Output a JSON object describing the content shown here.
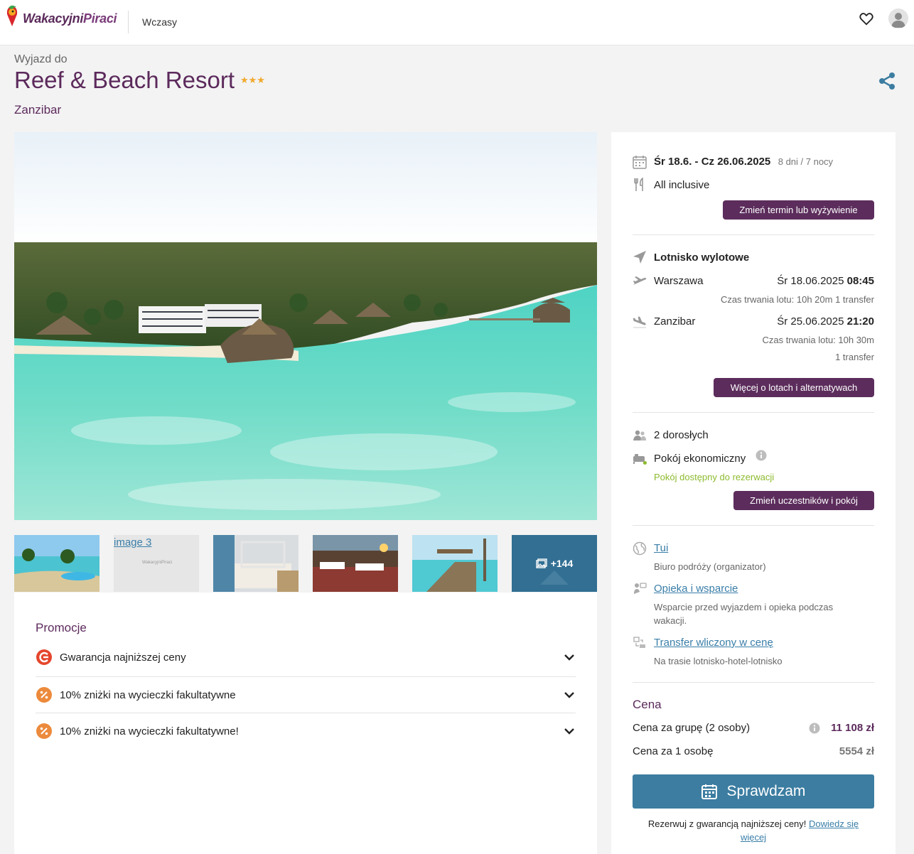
{
  "header": {
    "logo_part1": "Wakacyjni",
    "logo_part2": "Piraci",
    "nav_item": "Wczasy"
  },
  "hotel": {
    "subtitle": "Wyjazd do",
    "name": "Reef & Beach Resort",
    "stars": "★★★",
    "location": "Zanzibar"
  },
  "gallery": {
    "thumb_alt": "image 3",
    "thumb_logo": "WakacyjniPiraci",
    "more_count": "+144"
  },
  "promotions": {
    "title": "Promocje",
    "items": [
      {
        "label": "Gwarancja najniższej ceny"
      },
      {
        "label": "10% zniżki na wycieczki fakultatywne"
      },
      {
        "label": "10% zniżki na wycieczki fakultatywne!"
      }
    ]
  },
  "trip": {
    "dates": "Śr 18.6. - Cz 26.06.2025",
    "duration": "8 dni / 7 nocy",
    "board": "All inclusive",
    "change_term_button": "Zmień termin lub wyżywienie"
  },
  "flights": {
    "section_title": "Lotnisko wylotowe",
    "outbound": {
      "city": "Warszawa",
      "date": "Śr 18.06.2025",
      "time": "08:45",
      "info": "Czas trwania lotu: 10h 20m 1 transfer"
    },
    "return": {
      "city": "Zanzibar",
      "date": "Śr 25.06.2025",
      "time": "21:20",
      "info1": "Czas trwania lotu: 10h 30m",
      "info2": "1 transfer"
    },
    "more_button": "Więcej o lotach i alternatywach"
  },
  "participants": {
    "adults": "2 dorosłych",
    "room": "Pokój ekonomiczny",
    "availability": "Pokój dostępny do rezerwacji",
    "change_button": "Zmień uczestników i pokój"
  },
  "organizer": {
    "name": "Tui",
    "name_desc": "Biuro podróży (organizator)",
    "support": "Opieka i wsparcie",
    "support_desc_1": "Wsparcie przed wyjazdem i opieka podczas",
    "support_desc_2": "wakacji.",
    "transfer": "Transfer wliczony w cenę",
    "transfer_desc": "Na trasie lotnisko-hotel-lotnisko"
  },
  "price": {
    "title": "Cena",
    "group_label": "Cena za grupę (2 osoby)",
    "group_value": "11 108 zł",
    "person_label": "Cena za 1 osobę",
    "person_value": "5554 zł",
    "cta": "Sprawdzam",
    "guarantee_text": "Rezerwuj z gwarancją najniższej ceny!",
    "guarantee_link_1": "Dowiedz się",
    "guarantee_link_2": "więcej"
  },
  "colors": {
    "brand_purple": "#5c2d5c",
    "cta_blue": "#3c7da1",
    "star_gold": "#f0a92d",
    "available_green": "#8dbb2f"
  }
}
